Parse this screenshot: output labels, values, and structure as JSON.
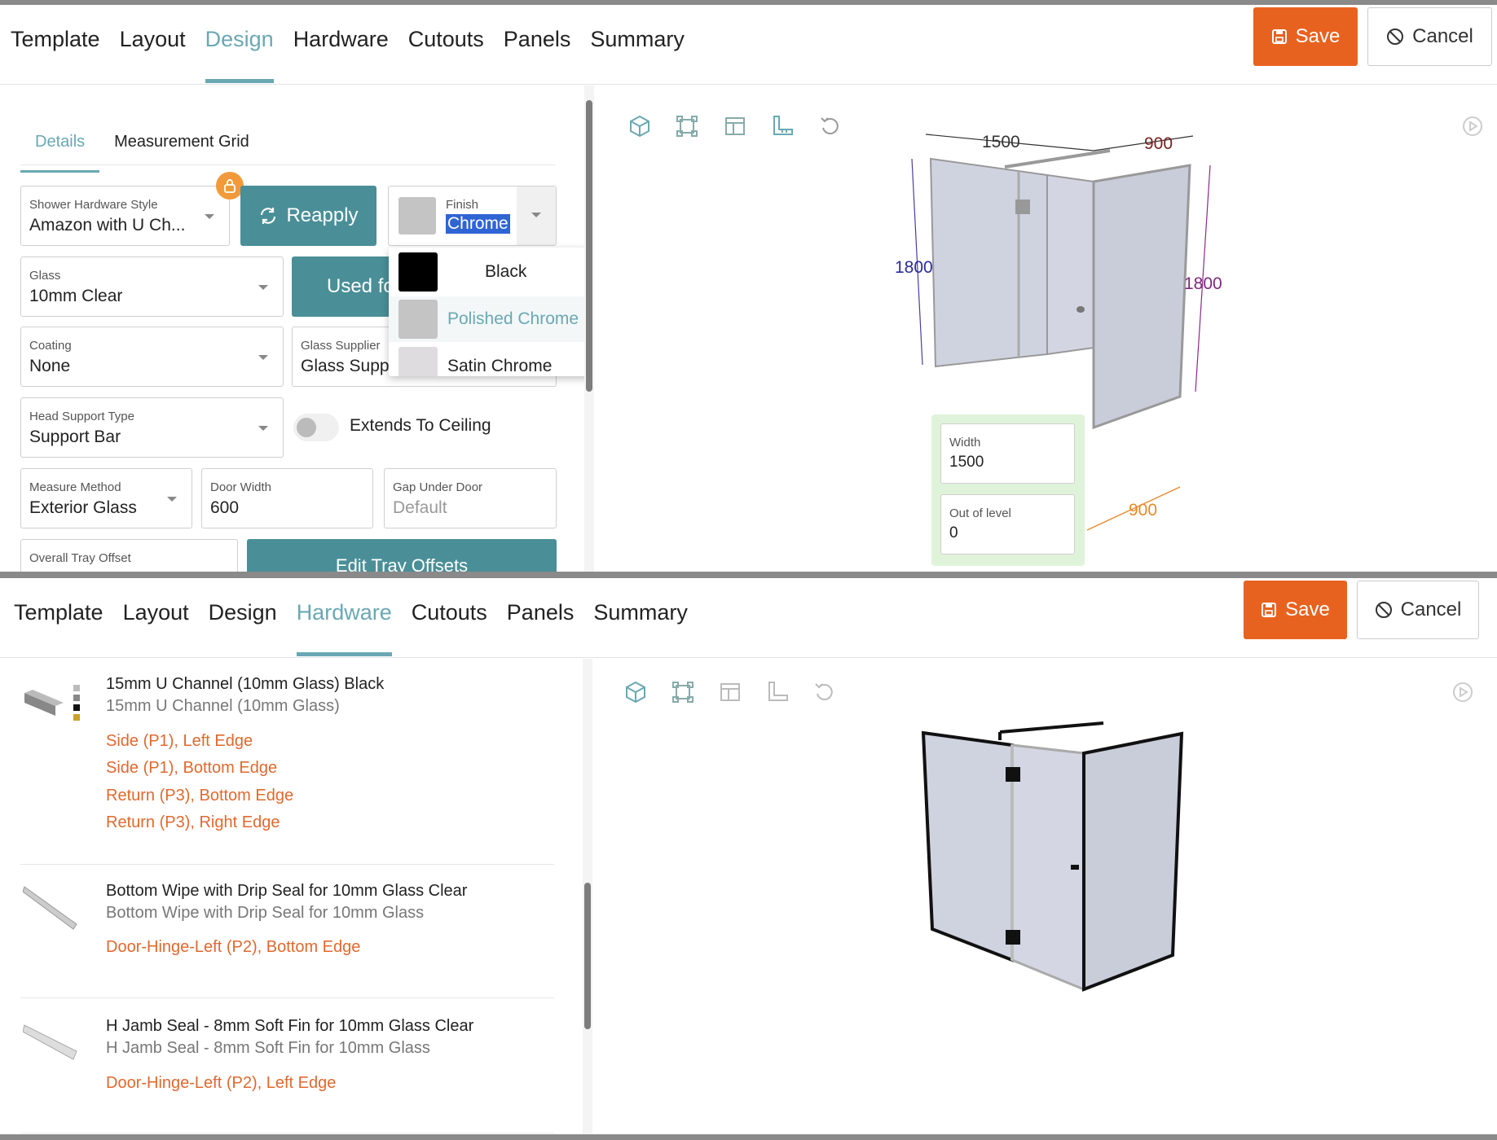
{
  "colors": {
    "accent": "#6aa8b3",
    "save": "#e8621f",
    "teal_button": "#4a8f97",
    "location_text": "#e0692e"
  },
  "top": {
    "tabs": [
      "Template",
      "Layout",
      "Design",
      "Hardware",
      "Cutouts",
      "Panels",
      "Summary"
    ],
    "active_tab": "Design",
    "save_label": "Save",
    "cancel_label": "Cancel",
    "subtabs": [
      "Details",
      "Measurement Grid"
    ],
    "hardware_style": {
      "label": "Shower Hardware Style",
      "value": "Amazon with U Ch..."
    },
    "reapply_label": "Reapply",
    "finish": {
      "label": "Finish",
      "value": "Chrome"
    },
    "finish_options": [
      {
        "label": "Black",
        "swatch": "#000000"
      },
      {
        "label": "Polished Chrome",
        "swatch": "#c4c4c4"
      },
      {
        "label": "Satin Chrome",
        "swatch": "#dedcdf"
      }
    ],
    "glass": {
      "label": "Glass",
      "value": "10mm Clear"
    },
    "used_for_label": "Used fo",
    "coating": {
      "label": "Coating",
      "value": "None"
    },
    "glass_supplier": {
      "label": "Glass Supplier",
      "value": "Glass Suppl"
    },
    "head_support": {
      "label": "Head Support Type",
      "value": "Support Bar"
    },
    "extends_label": "Extends To Ceiling",
    "measure_method": {
      "label": "Measure Method",
      "value": "Exterior Glass"
    },
    "door_width": {
      "label": "Door Width",
      "value": "600"
    },
    "gap_under_door": {
      "label": "Gap Under Door",
      "value": "Default"
    },
    "tray_offset": {
      "label": "Overall Tray Offset",
      "value": ""
    },
    "edit_tray_label": "Edit Tray Offsets",
    "dimensions": {
      "top_width": "1500",
      "top_return": "900",
      "left_height": "1800",
      "right_height": "1800",
      "bottom_return": "900"
    },
    "width_input": {
      "label": "Width",
      "value": "1500"
    },
    "out_of_level": {
      "label": "Out of level",
      "value": "0"
    }
  },
  "bottom": {
    "tabs": [
      "Template",
      "Layout",
      "Design",
      "Hardware",
      "Cutouts",
      "Panels",
      "Summary"
    ],
    "active_tab": "Hardware",
    "save_label": "Save",
    "cancel_label": "Cancel",
    "items": [
      {
        "title": "15mm U Channel (10mm Glass) Black",
        "subtitle": "15mm U Channel (10mm Glass)",
        "locations": [
          "Side (P1), Left Edge",
          "Side (P1), Bottom Edge",
          "Return (P3), Bottom Edge",
          "Return (P3), Right Edge"
        ]
      },
      {
        "title": "Bottom Wipe with Drip Seal for 10mm Glass Clear",
        "subtitle": "Bottom Wipe with Drip Seal for 10mm Glass",
        "locations": [
          "Door-Hinge-Left (P2), Bottom Edge"
        ]
      },
      {
        "title": "H Jamb Seal - 8mm Soft Fin for 10mm Glass Clear",
        "subtitle": "H Jamb Seal - 8mm Soft Fin for 10mm Glass",
        "locations": [
          "Door-Hinge-Left (P2), Left Edge"
        ]
      }
    ]
  }
}
